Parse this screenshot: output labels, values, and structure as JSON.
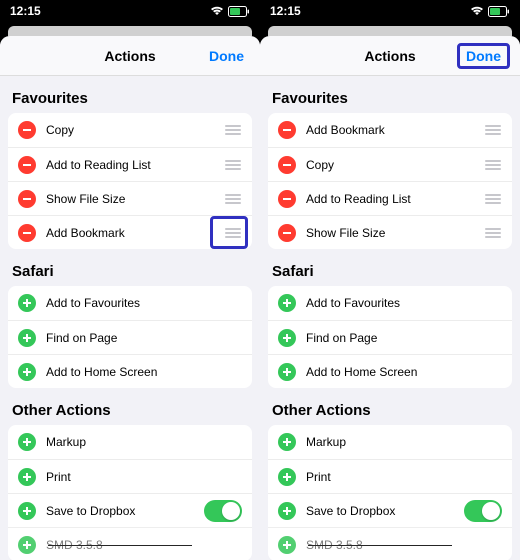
{
  "status": {
    "time": "12:15"
  },
  "nav": {
    "title": "Actions",
    "done": "Done"
  },
  "sections": {
    "favourites": "Favourites",
    "safari": "Safari",
    "other": "Other Actions"
  },
  "left": {
    "favourites": [
      {
        "label": "Copy"
      },
      {
        "label": "Add to Reading List"
      },
      {
        "label": "Show File Size"
      },
      {
        "label": "Add Bookmark",
        "highlightDrag": true
      }
    ]
  },
  "right": {
    "favourites": [
      {
        "label": "Add Bookmark"
      },
      {
        "label": "Copy"
      },
      {
        "label": "Add to Reading List"
      },
      {
        "label": "Show File Size"
      }
    ],
    "highlightDone": true
  },
  "safariItems": [
    {
      "label": "Add to Favourites"
    },
    {
      "label": "Find on Page"
    },
    {
      "label": "Add to Home Screen"
    }
  ],
  "otherItems": [
    {
      "label": "Markup"
    },
    {
      "label": "Print"
    },
    {
      "label": "Save to Dropbox",
      "toggle": true
    },
    {
      "label": "SMD 3.5.8",
      "truncated": true
    }
  ]
}
